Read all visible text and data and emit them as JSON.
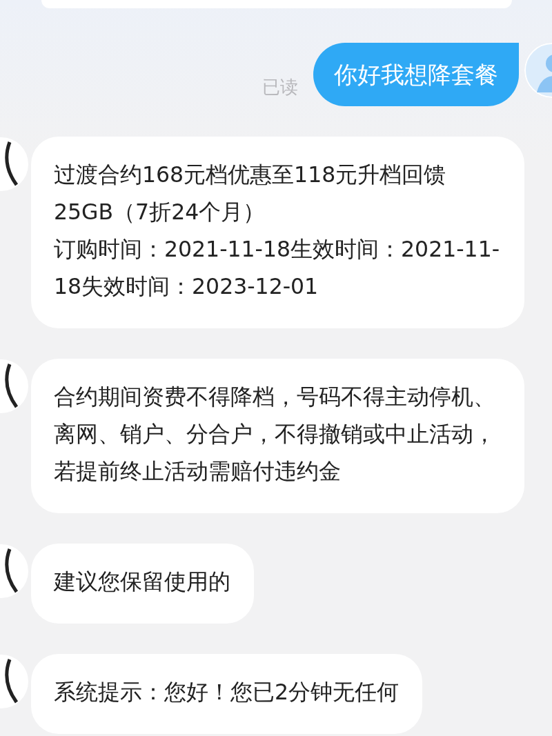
{
  "messages": [
    {
      "kind": "sent",
      "text": "你好我想降套餐",
      "receipt": "已读"
    },
    {
      "kind": "received",
      "paragraphs": [
        "过渡合约168元档优惠至118元升档回馈25GB（7折24个月）",
        "订购时间：2021-11-18生效时间：2021-11-18失效时间：2023-12-01"
      ]
    },
    {
      "kind": "received",
      "paragraphs": [
        "合约期间资费不得降档，号码不得主动停机、离网、销户、分合户，不得撤销或中止活动，若提前终止活动需赔付违约金"
      ]
    },
    {
      "kind": "received",
      "paragraphs": [
        "建议您保留使用的"
      ]
    },
    {
      "kind": "received",
      "paragraphs": [
        "系统提示：您好！您已2分钟无任何"
      ]
    }
  ]
}
